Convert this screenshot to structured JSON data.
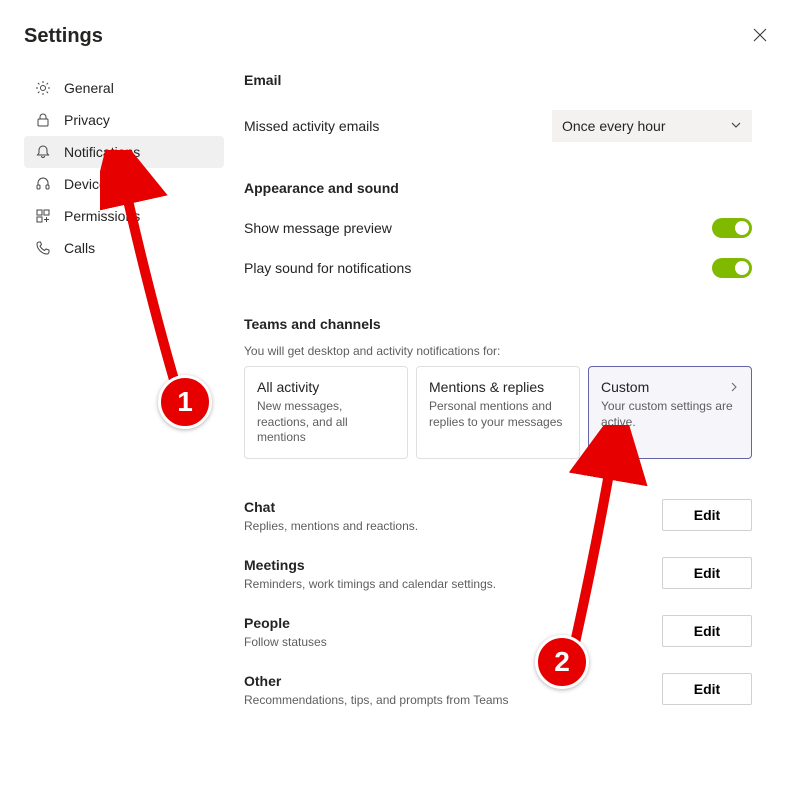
{
  "title": "Settings",
  "sidebar": {
    "items": [
      {
        "label": "General"
      },
      {
        "label": "Privacy"
      },
      {
        "label": "Notifications"
      },
      {
        "label": "Devices"
      },
      {
        "label": "Permissions"
      },
      {
        "label": "Calls"
      }
    ]
  },
  "email": {
    "heading": "Email",
    "missed_label": "Missed activity emails",
    "frequency": "Once every hour"
  },
  "appearance": {
    "heading": "Appearance and sound",
    "preview_label": "Show message preview",
    "sound_label": "Play sound for notifications"
  },
  "teams_channels": {
    "heading": "Teams and channels",
    "desc": "You will get desktop and activity notifications for:",
    "cards": [
      {
        "title": "All activity",
        "desc": "New messages, reactions, and all mentions"
      },
      {
        "title": "Mentions & replies",
        "desc": "Personal mentions and replies to your messages"
      },
      {
        "title": "Custom",
        "desc": "Your custom settings are active."
      }
    ]
  },
  "sections": [
    {
      "name": "Chat",
      "desc": "Replies, mentions and reactions.",
      "btn": "Edit"
    },
    {
      "name": "Meetings",
      "desc": "Reminders, work timings and calendar settings.",
      "btn": "Edit"
    },
    {
      "name": "People",
      "desc": "Follow statuses",
      "btn": "Edit"
    },
    {
      "name": "Other",
      "desc": "Recommendations, tips, and prompts from Teams",
      "btn": "Edit"
    }
  ],
  "annotations": {
    "b1": "1",
    "b2": "2"
  }
}
